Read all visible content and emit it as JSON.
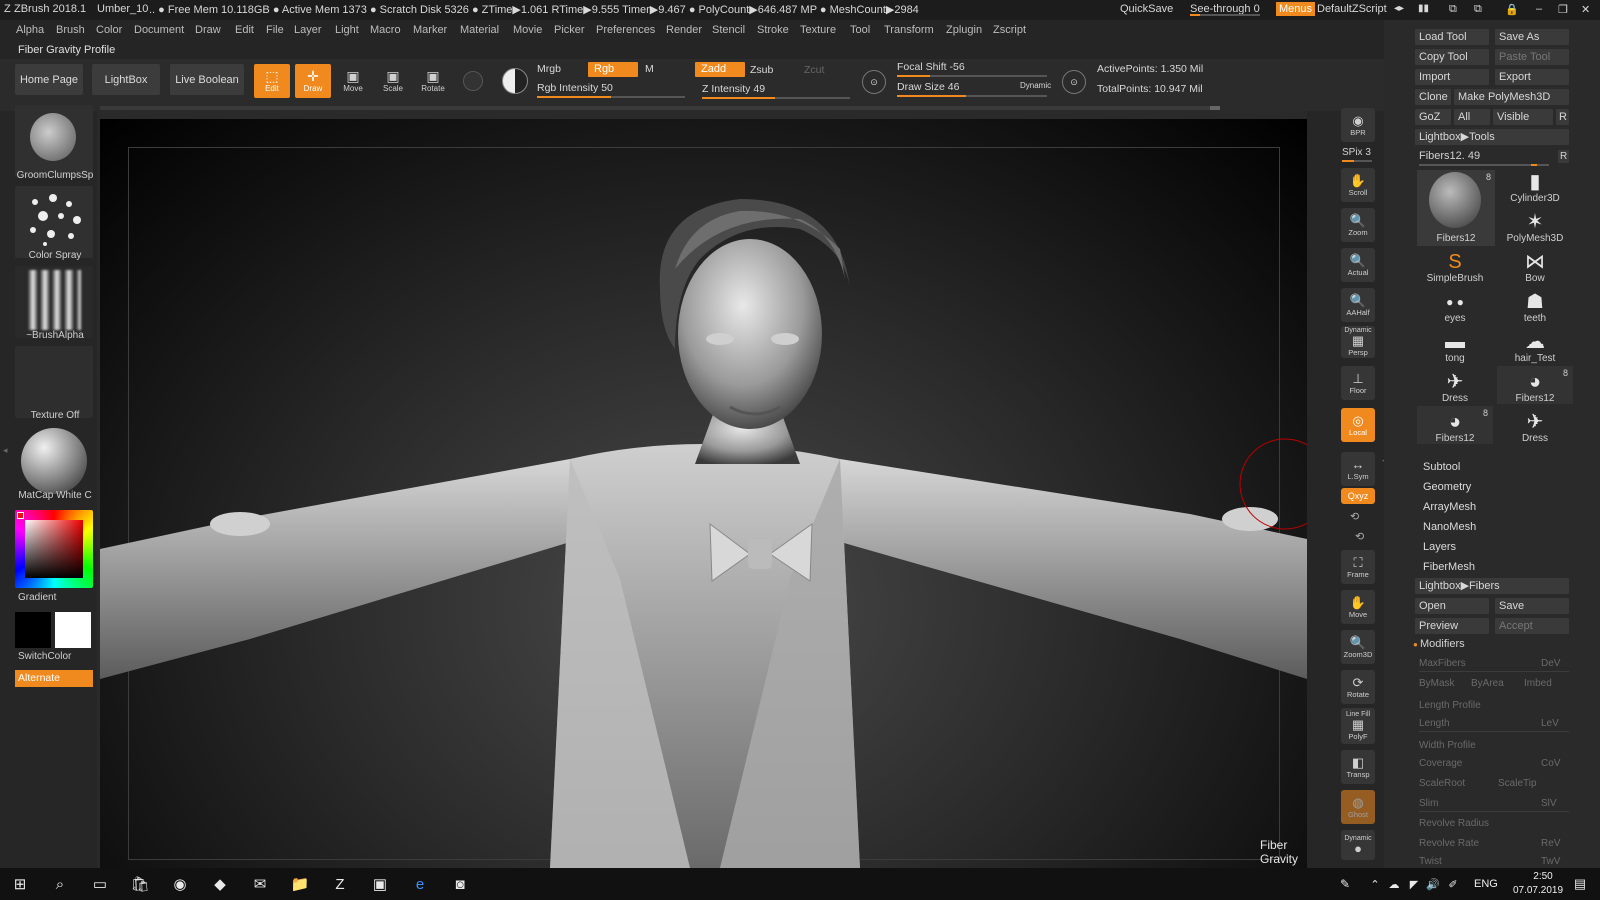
{
  "titlebar": {
    "app": "ZBrush 2018.1",
    "project": "Umber_10",
    "stats": ".. ● Free Mem 10.118GB ● Active Mem 1373 ● Scratch Disk 5326 ● ZTime▶1.061 RTime▶9.555 Timer▶9.467 ● PolyCount▶646.487 MP ● MeshCount▶2984",
    "quicksave": "QuickSave",
    "seethrough": "See-through  0",
    "menus": "Menus",
    "script": "DefaultZScript"
  },
  "menubar": [
    "Alpha",
    "Brush",
    "Color",
    "Document",
    "Draw",
    "Edit",
    "File",
    "Layer",
    "Light",
    "Macro",
    "Marker",
    "Material",
    "Movie",
    "Picker",
    "Preferences",
    "Render",
    "Stencil",
    "Stroke",
    "Texture",
    "Tool",
    "Transform",
    "Zplugin",
    "Zscript"
  ],
  "subbar": {
    "label": "Fiber Gravity Profile"
  },
  "toolshelf": {
    "home": "Home Page",
    "lightbox": "LightBox",
    "liveboolean": "Live Boolean",
    "edit": "Edit",
    "draw": "Draw",
    "move": "Move",
    "scale": "Scale",
    "rotate": "Rotate",
    "mrgb": "Mrgb",
    "rgb": "Rgb",
    "m": "M",
    "zadd": "Zadd",
    "zsub": "Zsub",
    "zcut": "Zcut",
    "rgb_intensity": "Rgb Intensity 50",
    "z_intensity": "Z Intensity 49",
    "focal_shift": "Focal Shift -56",
    "draw_size": "Draw Size 46",
    "dynamic": "Dynamic",
    "active_points": "ActivePoints: 1.350 Mil",
    "total_points": "TotalPoints: 10.947 Mil",
    "sliders": {
      "rgb_intensity": 50,
      "z_intensity": 49,
      "focal_shift": -56,
      "draw_size": 46
    }
  },
  "leftshelf": {
    "brush": "GroomClumpsSp",
    "stroke": "Color Spray",
    "alpha": "~BrushAlpha",
    "texture": "Texture Off",
    "material": "MatCap White C",
    "gradient": "Gradient",
    "switchcolor": "SwitchColor",
    "alternate": "Alternate"
  },
  "rightshelf": {
    "bpr": "BPR",
    "spix": "SPix 3",
    "scroll": "Scroll",
    "zoom": "Zoom",
    "actual": "Actual",
    "aahalf": "AAHalf",
    "dynamic": "Dynamic",
    "persp": "Persp",
    "floor": "Floor",
    "local": "Local",
    "lsym": "L.Sym",
    "xyz": "Qxyz",
    "frame": "Frame",
    "move": "Move",
    "zoom3d": "Zoom3D",
    "rotate": "Rotate",
    "linefill": "Line Fill",
    "polyf": "PolyF",
    "transp": "Transp",
    "ghost": "Ghost",
    "dynamic2": "Dynamic"
  },
  "tray": {
    "load_tool": "Load Tool",
    "save_as": "Save As",
    "copy_tool": "Copy Tool",
    "paste_tool": "Paste Tool",
    "import": "Import",
    "export": "Export",
    "clone": "Clone",
    "make_polymesh": "Make PolyMesh3D",
    "goz": "GoZ",
    "all": "All",
    "visible": "Visible",
    "r": "R",
    "lightbox_tools": "Lightbox▶Tools",
    "fibers_slider": "Fibers12. 49",
    "tools": [
      {
        "label": "Fibers12",
        "badge": "8"
      },
      {
        "label": "Cylinder3D",
        "badge": ""
      },
      {
        "label": "PolyMesh3D",
        "badge": ""
      },
      {
        "label": "SimpleBrush",
        "badge": ""
      },
      {
        "label": "Bow",
        "badge": ""
      },
      {
        "label": "eyes",
        "badge": ""
      },
      {
        "label": "teeth",
        "badge": ""
      },
      {
        "label": "tong",
        "badge": ""
      },
      {
        "label": "hair_Test",
        "badge": ""
      },
      {
        "label": "Dress",
        "badge": ""
      },
      {
        "label": "Fibers12",
        "badge": "8"
      },
      {
        "label": "Fibers12",
        "badge": "8"
      },
      {
        "label": "Dress",
        "badge": ""
      }
    ],
    "sections": [
      "Subtool",
      "Geometry",
      "ArrayMesh",
      "NanoMesh",
      "Layers",
      "FiberMesh"
    ],
    "lightbox_fibers": "Lightbox▶Fibers",
    "open": "Open",
    "save": "Save",
    "preview": "Preview",
    "accept": "Accept",
    "modifiers": "Modifiers",
    "mods": [
      "MaxFibers",
      "DeV",
      "ByMask",
      "ByArea",
      "Imbed",
      "Length Profile",
      "Length",
      "LeV",
      "Width Profile",
      "Coverage",
      "CoV",
      "ScaleRoot",
      "ScaleTip",
      "Slim",
      "SlV",
      "Revolve Radius",
      "Revolve Rate",
      "ReV",
      "Twist",
      "TwV"
    ]
  },
  "viewport": {
    "overlay_label": "Fiber Gravity Profile"
  },
  "taskbar": {
    "lang": "ENG",
    "time": "2:50",
    "date": "07.07.2019"
  }
}
